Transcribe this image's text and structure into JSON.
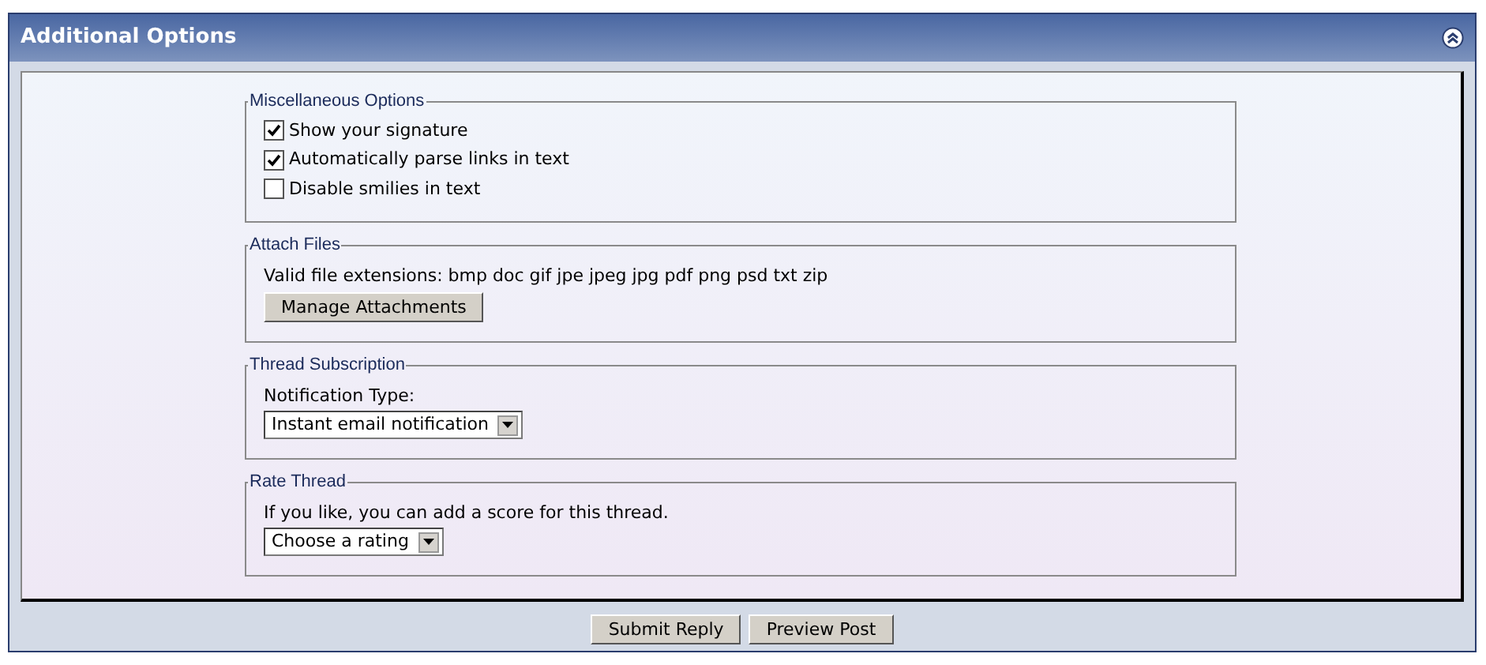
{
  "panel": {
    "title": "Additional Options"
  },
  "sections": [
    {
      "kind": "checkboxes",
      "legend": "Miscellaneous Options",
      "options": [
        {
          "label": "Show your signature",
          "checked": true
        },
        {
          "label": "Automatically parse links in text",
          "checked": true
        },
        {
          "label": "Disable smilies in text",
          "checked": false
        }
      ]
    },
    {
      "kind": "attach",
      "legend": "Attach Files",
      "text": "Valid file extensions: bmp doc gif jpe jpeg jpg pdf png psd txt zip",
      "button": "Manage Attachments"
    },
    {
      "kind": "select",
      "legend": "Thread Subscription",
      "label": "Notification Type:",
      "value": "Instant email notification"
    },
    {
      "kind": "select",
      "legend": "Rate Thread",
      "label": "If you like, you can add a score for this thread.",
      "value": "Choose a rating"
    }
  ],
  "buttons": [
    "Submit Reply",
    "Preview Post"
  ]
}
